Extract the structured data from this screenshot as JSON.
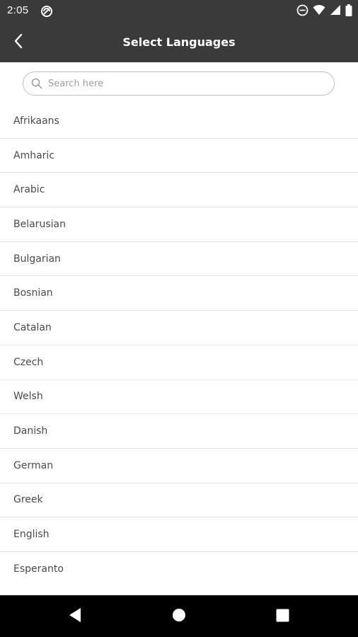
{
  "status_bar": {
    "time": "2:05",
    "icons": [
      "data-saver-icon",
      "do-not-disturb-icon",
      "wifi-icon",
      "signal-icon",
      "battery-icon"
    ]
  },
  "app_bar": {
    "title": "Select Languages",
    "back_icon": "chevron-left-icon"
  },
  "search": {
    "placeholder": "Search here",
    "value": "",
    "icon": "search-icon"
  },
  "languages": [
    {
      "label": "Afrikaans"
    },
    {
      "label": "Amharic"
    },
    {
      "label": "Arabic"
    },
    {
      "label": "Belarusian"
    },
    {
      "label": "Bulgarian"
    },
    {
      "label": "Bosnian"
    },
    {
      "label": "Catalan"
    },
    {
      "label": "Czech"
    },
    {
      "label": "Welsh"
    },
    {
      "label": "Danish"
    },
    {
      "label": "German"
    },
    {
      "label": "Greek"
    },
    {
      "label": "English"
    },
    {
      "label": "Esperanto"
    }
  ],
  "nav_bar": {
    "icons": [
      "nav-back-icon",
      "nav-home-icon",
      "nav-recents-icon"
    ]
  },
  "colors": {
    "app_bar": "#3a3a3a",
    "text_primary": "#4a4a4a",
    "divider": "#e8e8e8",
    "search_border": "#bdbdbd",
    "nav_bar": "#000000"
  }
}
